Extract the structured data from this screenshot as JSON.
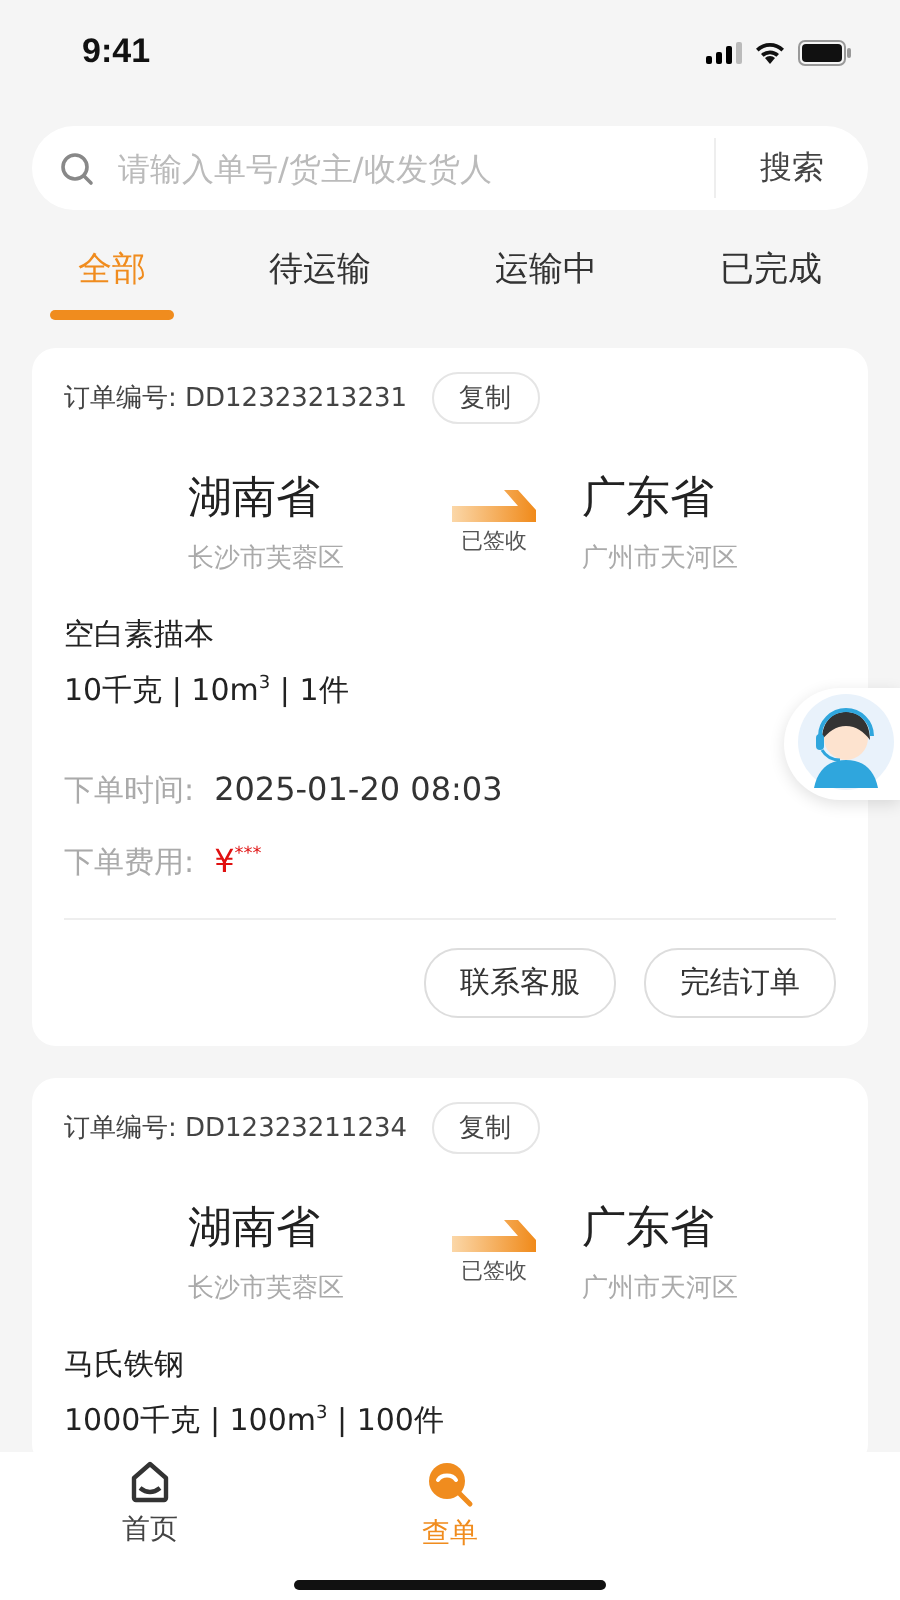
{
  "status_bar": {
    "time": "9:41"
  },
  "search": {
    "placeholder": "请输入单号/货主/收发货人",
    "button": "搜索"
  },
  "tabs": [
    {
      "label": "全部",
      "selected": true
    },
    {
      "label": "待运输",
      "selected": false
    },
    {
      "label": "运输中",
      "selected": false
    },
    {
      "label": "已完成",
      "selected": false
    }
  ],
  "orders": [
    {
      "order_no": "订单编号: DD12323213231",
      "copy": "复制",
      "origin": {
        "province": "湖南省",
        "city": "长沙市芙蓉区"
      },
      "status": "已签收",
      "destination": {
        "province": "广东省",
        "city": "广州市天河区"
      },
      "goods": "空白素描本",
      "specs": "10千克 | 10m$^{3}$ | 1件",
      "fields": [
        {
          "label": "下单时间:",
          "value": "2025-01-20 08:03",
          "kind": "text"
        },
        {
          "label": "下单费用:",
          "value": "¥$^{***}$",
          "kind": "price"
        }
      ],
      "actions": [
        "联系客服",
        "完结订单"
      ]
    },
    {
      "order_no": "订单编号: DD12323211234",
      "copy": "复制",
      "origin": {
        "province": "湖南省",
        "city": "长沙市芙蓉区"
      },
      "status": "已签收",
      "destination": {
        "province": "广东省",
        "city": "广州市天河区"
      },
      "goods": "马氏铁钢",
      "specs": "1000千克 | 100m$^{3}$ | 100件"
    }
  ],
  "nav": [
    {
      "label": "首页",
      "kind": "home",
      "selected": false
    },
    {
      "label": "查单",
      "kind": "search",
      "selected": true
    }
  ]
}
